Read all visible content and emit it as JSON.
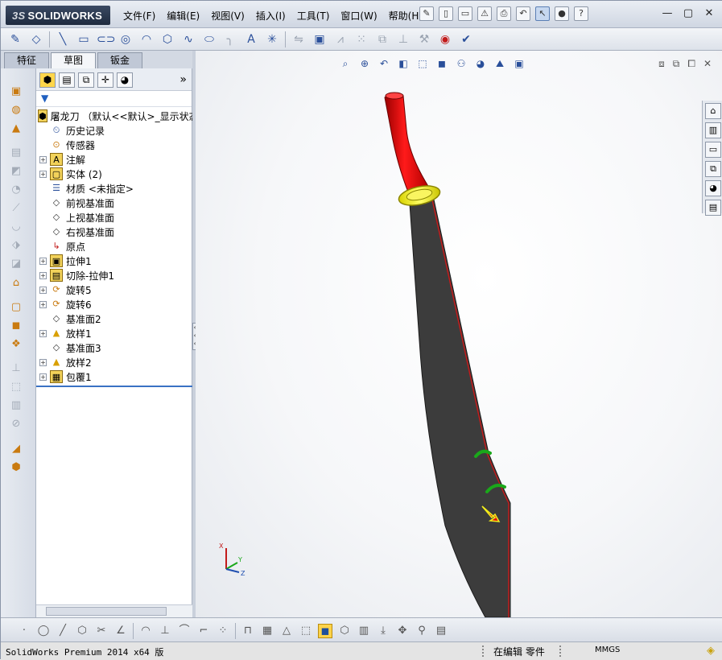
{
  "app": {
    "brand_ds": "3S",
    "brand_name": "SOLIDWORKS"
  },
  "menu": [
    "文件(F)",
    "编辑(E)",
    "视图(V)",
    "插入(I)",
    "工具(T)",
    "窗口(W)",
    "帮助(H)"
  ],
  "tabs": [
    {
      "label": "特征",
      "active": false
    },
    {
      "label": "草图",
      "active": true
    },
    {
      "label": "钣金",
      "active": false
    }
  ],
  "feature_tree": {
    "root": "屠龙刀 （默认<<默认>_显示状态",
    "items": [
      {
        "label": "历史记录",
        "expandable": false,
        "icon": "history-icon"
      },
      {
        "label": "传感器",
        "expandable": false,
        "icon": "sensor-icon"
      },
      {
        "label": "注解",
        "expandable": true,
        "icon": "annotation-icon"
      },
      {
        "label": "实体 (2)",
        "expandable": true,
        "icon": "solid-bodies-icon"
      },
      {
        "label": "材质 <未指定>",
        "expandable": false,
        "icon": "material-icon"
      },
      {
        "label": "前视基准面",
        "expandable": false,
        "icon": "plane-icon"
      },
      {
        "label": "上视基准面",
        "expandable": false,
        "icon": "plane-icon"
      },
      {
        "label": "右视基准面",
        "expandable": false,
        "icon": "plane-icon"
      },
      {
        "label": "原点",
        "expandable": false,
        "icon": "origin-icon"
      },
      {
        "label": "拉伸1",
        "expandable": true,
        "icon": "extrude-icon"
      },
      {
        "label": "切除-拉伸1",
        "expandable": true,
        "icon": "cut-extrude-icon"
      },
      {
        "label": "旋转5",
        "expandable": true,
        "icon": "revolve-icon"
      },
      {
        "label": "旋转6",
        "expandable": true,
        "icon": "revolve-icon"
      },
      {
        "label": "基准面2",
        "expandable": false,
        "icon": "plane-icon"
      },
      {
        "label": "放样1",
        "expandable": true,
        "icon": "loft-icon"
      },
      {
        "label": "基准面3",
        "expandable": false,
        "icon": "plane-icon"
      },
      {
        "label": "放样2",
        "expandable": true,
        "icon": "loft-icon"
      },
      {
        "label": "包覆1",
        "expandable": true,
        "icon": "wrap-icon"
      }
    ]
  },
  "triad": {
    "x": "X",
    "y": "Y",
    "z": "Z"
  },
  "status": {
    "product": "SolidWorks Premium 2014 x64 版",
    "mode": "在编辑 零件",
    "units": "MMGS"
  },
  "colors": {
    "handle": "#d40000",
    "guard": "#f2ee1a",
    "blade": "#3c3c3c",
    "accent": "#3a72c4"
  }
}
